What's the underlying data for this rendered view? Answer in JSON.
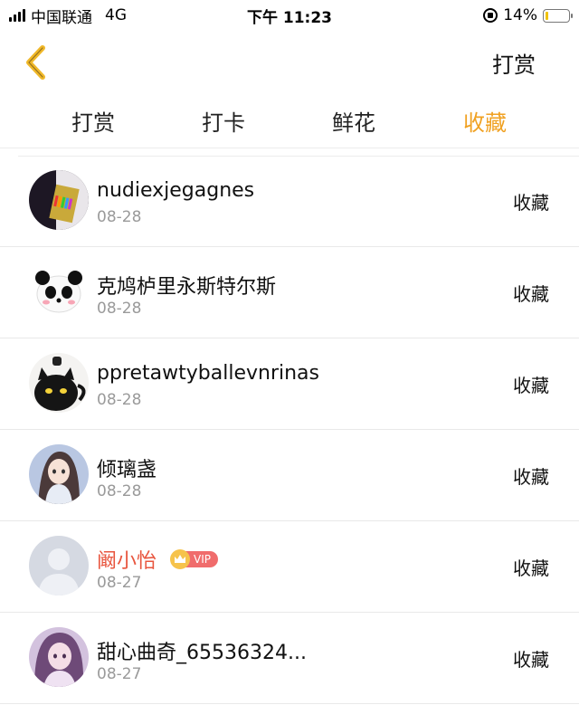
{
  "status_bar": {
    "carrier": "中国联通",
    "network": "4G",
    "time": "下午 11:23",
    "battery_percent": "14%",
    "battery_level": 0.14
  },
  "header": {
    "back_icon": "chevron-left-icon",
    "action_label": "打赏",
    "accent_color": "#f0a122"
  },
  "tabs": [
    {
      "label": "打赏",
      "active": false
    },
    {
      "label": "打卡",
      "active": false
    },
    {
      "label": "鲜花",
      "active": false
    },
    {
      "label": "收藏",
      "active": true
    }
  ],
  "list": [
    {
      "name": "nudiexjegagnes",
      "date": "08-28",
      "action": "收藏",
      "avatar": "pencils-photo"
    },
    {
      "name": "克鸠栌里永斯特尔斯",
      "date": "08-28",
      "action": "收藏",
      "avatar": "panda-sticker"
    },
    {
      "name": "ppretawtyballevnrinas",
      "date": "08-28",
      "action": "收藏",
      "avatar": "black-cat-cup"
    },
    {
      "name": "倾璃盏",
      "date": "08-28",
      "action": "收藏",
      "avatar": "anime-girl"
    },
    {
      "name": "阚小怡",
      "date": "08-27",
      "action": "收藏",
      "avatar": "default-user",
      "vip": true,
      "vip_label": "VIP"
    },
    {
      "name": "甜心曲奇_65536324...",
      "date": "08-27",
      "action": "收藏",
      "avatar": "anime-girl-purple"
    }
  ]
}
